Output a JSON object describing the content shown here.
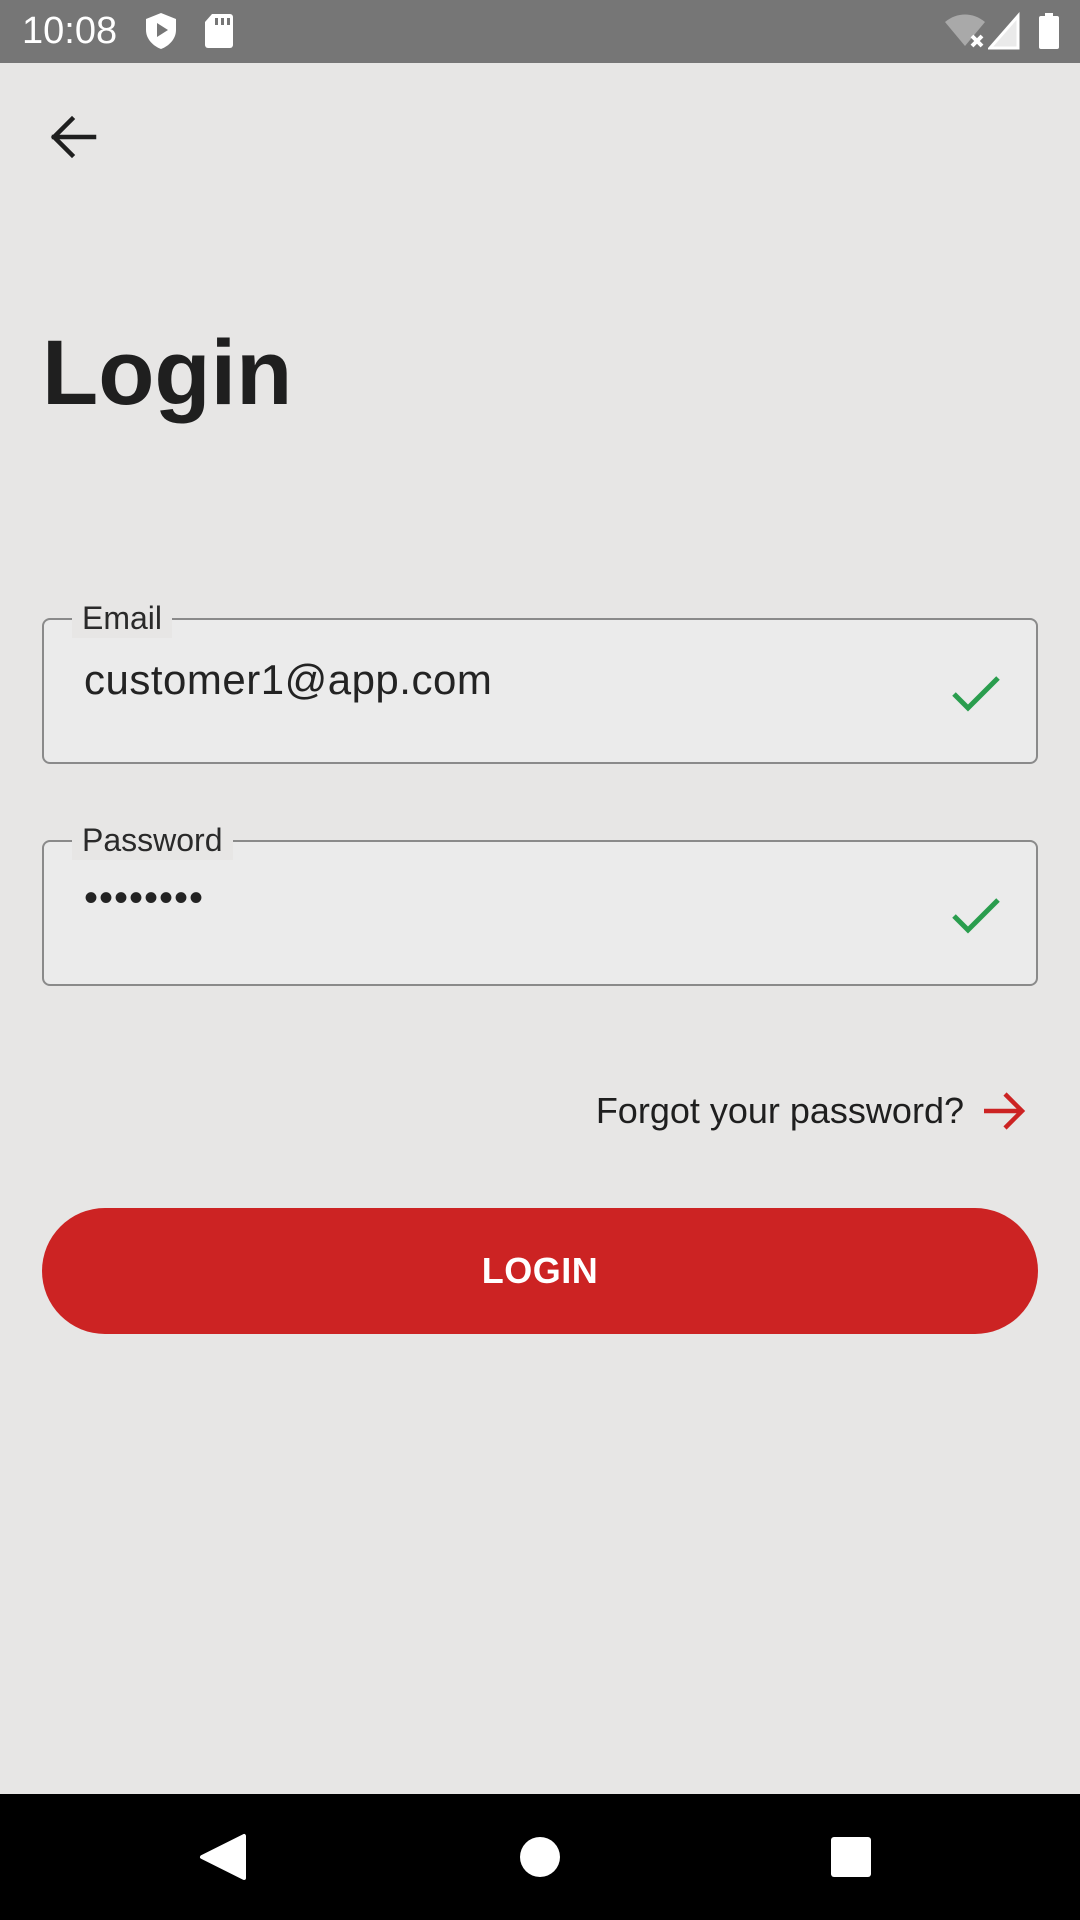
{
  "status_bar": {
    "time": "10:08",
    "icons": [
      "shield-play-icon",
      "sd-card-icon",
      "wifi-off-icon",
      "signal-icon",
      "battery-icon"
    ]
  },
  "header": {
    "back_icon": "back-arrow-icon"
  },
  "page": {
    "title": "Login"
  },
  "form": {
    "email": {
      "label": "Email",
      "value": "customer1@app.com",
      "valid_icon": "check-icon"
    },
    "password": {
      "label": "Password",
      "value": "••••••••",
      "valid_icon": "check-icon"
    },
    "forgot_password": {
      "label": "Forgot your password?",
      "icon": "arrow-right-icon"
    },
    "login_button": {
      "label": "LOGIN"
    }
  },
  "colors": {
    "background": "#e7e6e5",
    "accent": "#cc2323",
    "valid": "#2a9d4e",
    "status_bar": "#767676"
  },
  "nav_bar": {
    "buttons": [
      "back-nav-icon",
      "home-nav-icon",
      "recents-nav-icon"
    ]
  }
}
